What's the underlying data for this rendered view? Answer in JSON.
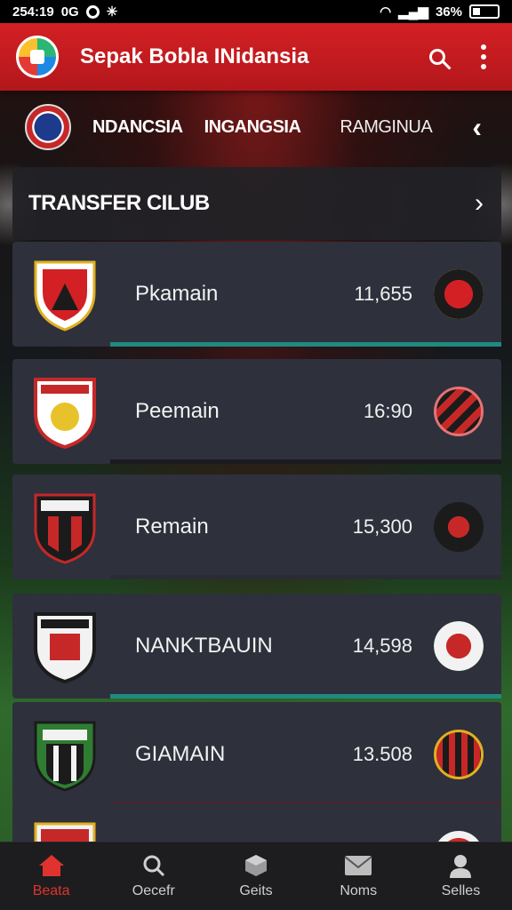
{
  "status_bar": {
    "time": "254:19",
    "carrier": "0G",
    "battery": "36%"
  },
  "app_bar": {
    "title": "Sepak Bobla INidansia",
    "logo_icon": "app-logo-icon",
    "search_icon": "search-icon",
    "menu_icon": "more-vert-icon"
  },
  "league_tabs": {
    "badge_icon": "league-badge-icon",
    "items": [
      "NDANCSIA",
      "INGANGSIA",
      "RAMGINUA"
    ],
    "arrow": "‹"
  },
  "section": {
    "title": "TRANSFER CILUB",
    "chevron": "›"
  },
  "rows": [
    {
      "name": "Pkamain",
      "value": "11,655",
      "bar_color": "#1f8a80"
    },
    {
      "name": "Peemain",
      "value": "16:90",
      "bar_color": "#1b1b1f"
    },
    {
      "name": "Remain",
      "value": "15,300",
      "bar_color": "#2a2c34"
    },
    {
      "name": "NANKTBAUIN",
      "value": "14,598",
      "bar_color": "#1f8a80"
    },
    {
      "name": "GIAMAIN",
      "value": "13.508",
      "bar_color": "#6a1c1c"
    },
    {
      "name": "",
      "value": "",
      "bar_color": ""
    }
  ],
  "bottom_nav": [
    {
      "label": "Beata",
      "icon": "home-icon",
      "active": true
    },
    {
      "label": "Oecefr",
      "icon": "search-icon",
      "active": false
    },
    {
      "label": "Geits",
      "icon": "cube-icon",
      "active": false
    },
    {
      "label": "Noms",
      "icon": "mail-icon",
      "active": false
    },
    {
      "label": "Selles",
      "icon": "person-icon",
      "active": false
    }
  ],
  "colors": {
    "primary_red": "#c81d21",
    "accent_teal": "#1f8a80",
    "card_bg": "#2e303c"
  }
}
